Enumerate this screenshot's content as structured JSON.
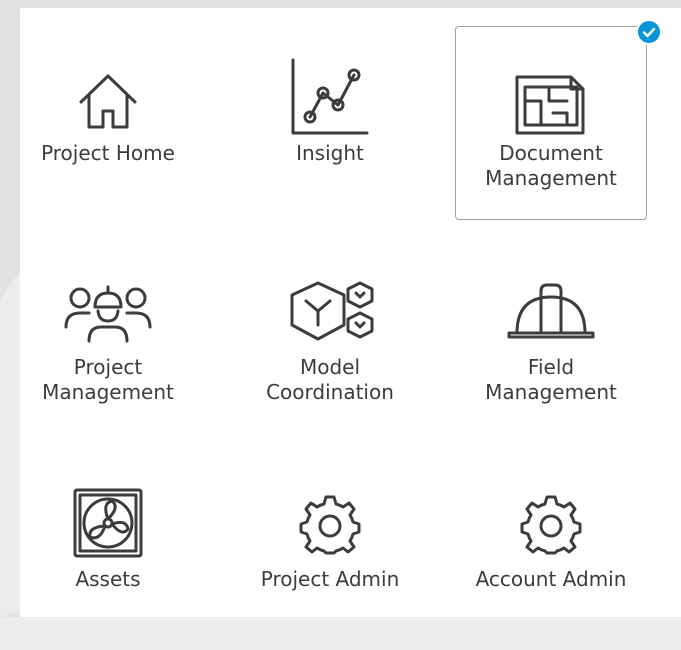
{
  "colors": {
    "icon_stroke": "#3c3c3c",
    "selected_border": "#9aa0a6",
    "check_badge": "#0696d7",
    "panel_bg": "#ffffff",
    "page_bg": "#ececec"
  },
  "modules": [
    {
      "label": "Project Home",
      "icon": "house-icon",
      "selected": false
    },
    {
      "label": "Insight",
      "icon": "line-chart-icon",
      "selected": false
    },
    {
      "label": "Document\nManagement",
      "icon": "blueprint-document-icon",
      "selected": true
    },
    {
      "label": "Project\nManagement",
      "icon": "team-hardhat-icon",
      "selected": false
    },
    {
      "label": "Model\nCoordination",
      "icon": "model-cube-icon",
      "selected": false
    },
    {
      "label": "Field\nManagement",
      "icon": "hardhat-icon",
      "selected": false
    },
    {
      "label": "Assets",
      "icon": "fan-unit-icon",
      "selected": false
    },
    {
      "label": "Project Admin",
      "icon": "gear-icon",
      "selected": false
    },
    {
      "label": "Account Admin",
      "icon": "gear-icon",
      "selected": false
    }
  ]
}
